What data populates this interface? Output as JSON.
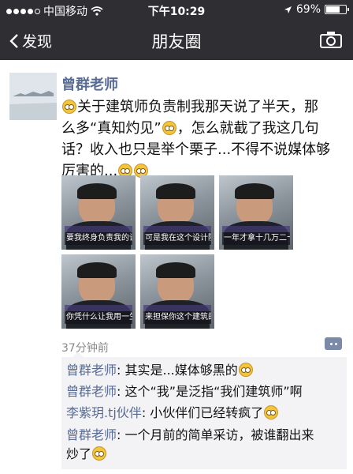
{
  "status_bar": {
    "carrier": "中国移动",
    "time": "下午10:29",
    "battery_percent": "69%",
    "battery_level": 0.69,
    "icons": [
      "signal-dots-icon",
      "wifi-icon",
      "location-arrow-icon",
      "battery-icon"
    ]
  },
  "nav": {
    "back_label": "发现",
    "title": "朋友圈",
    "icons": [
      "chevron-left-icon",
      "camera-icon"
    ]
  },
  "post": {
    "author": "曾群老师",
    "text_lines": [
      "关于建筑师负责制我那天说了半天，那",
      "么多“真知灼见”",
      "，怎么就截了我这几句",
      "话？收入也只是举个栗子...不得不说媒体够",
      "厉害的..."
    ],
    "photos": [
      {
        "caption": "要我终身负责我的设计"
      },
      {
        "caption": "可是我在这个设计院"
      },
      {
        "caption": "一年才拿十几万二十几万"
      },
      {
        "caption": "你凭什么让我用一生的安"
      },
      {
        "caption": "来担保你这个建筑的问题"
      }
    ],
    "time": "37分钟前"
  },
  "comments": [
    {
      "name": "曾群老师",
      "text": ": 其实是...媒体够黑的",
      "emoji": true
    },
    {
      "name": "曾群老师",
      "text": ": 这个“我”是泛指“我们建筑师”啊",
      "emoji": false
    },
    {
      "name": "李紫玥.tj伙伴",
      "text": ": 小伙伴们已经转疯了",
      "emoji": true
    },
    {
      "name": "曾群老师",
      "text": ": 一个月前的简单采访，被谁翻出来",
      "emoji": false
    },
    {
      "name": "",
      "text": "炒了",
      "emoji": true
    }
  ],
  "colors": {
    "bar_background": "#2e2e33",
    "link_blue": "#576b95",
    "comment_background": "#f3f3f5"
  }
}
